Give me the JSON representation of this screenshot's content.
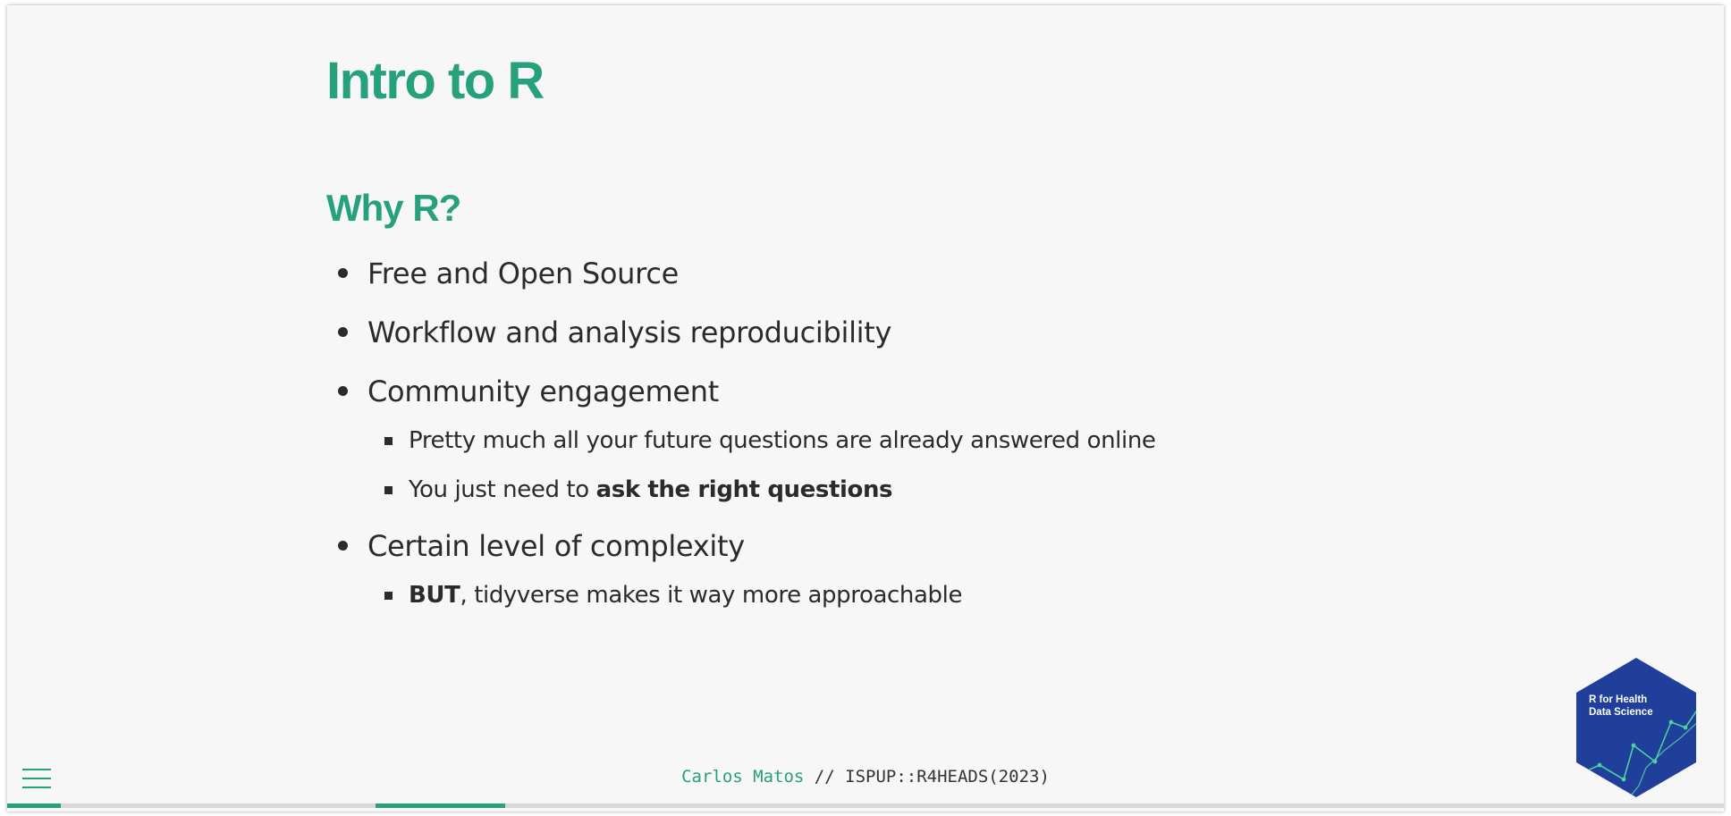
{
  "slide": {
    "title": "Intro to R",
    "subtitle": "Why R?",
    "bullets": [
      {
        "text": "Free and Open Source"
      },
      {
        "text": "Workflow and analysis reproducibility"
      },
      {
        "text": "Community engagement",
        "sub": [
          {
            "pre": "Pretty much all your future questions are already answered online",
            "bold": "",
            "post": ""
          },
          {
            "pre": "You just need to ",
            "bold": "ask the right questions",
            "post": ""
          }
        ]
      },
      {
        "text": "Certain level of complexity",
        "sub": [
          {
            "pre": "",
            "bold": "BUT",
            "post": ", tidyverse makes it way more approachable"
          }
        ]
      }
    ]
  },
  "footer": {
    "author": "Carlos Matos",
    "separator": " // ",
    "course": "ISPUP::R4HEADS(2023)"
  },
  "logo": {
    "line1": "R for Health",
    "line2": "Data Science",
    "hex_color": "#1f3f9a",
    "line_color": "#4fd0a0",
    "icon": "r4heads-hex-logo"
  },
  "menu": {
    "icon": "hamburger-menu-icon"
  },
  "colors": {
    "accent": "#26a17b",
    "text": "#2b2b2b",
    "background": "#f7f7f7"
  }
}
